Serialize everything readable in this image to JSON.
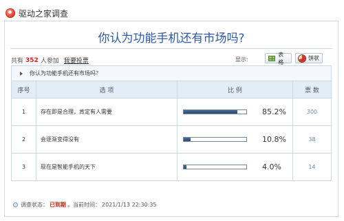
{
  "header": {
    "site_name": "驱动之家调查",
    "logo_icon": "globe-logo-icon"
  },
  "survey": {
    "title": "你认为功能手机还有市场吗?",
    "participants_prefix": "共有",
    "participants": "352",
    "participants_suffix": "人参加",
    "vote_link": "我要投票",
    "display_label": "显示:",
    "view_table": "表格",
    "view_pie": "饼状",
    "question_row": "你认为功能手机还有市场吗？"
  },
  "table": {
    "headers": {
      "no": "序号",
      "option": "选 项",
      "ratio": "比 例",
      "votes": "票 数"
    },
    "rows": [
      {
        "no": "1",
        "option": "存在即是合理，肯定有人需要",
        "percent_text": "85.2%",
        "fraction": 0.852,
        "votes": "300"
      },
      {
        "no": "2",
        "option": "会逐渐变得没有",
        "percent_text": "10.8%",
        "fraction": 0.108,
        "votes": "38"
      },
      {
        "no": "3",
        "option": "现在是智能手机的天下",
        "percent_text": "4.0%",
        "fraction": 0.04,
        "votes": "14"
      }
    ]
  },
  "status": {
    "label": "调查状态：",
    "state": "已到期",
    "time_label": "。当前时间：",
    "time": "2021/1/13 22:30:35"
  },
  "colors": {
    "title": "#2c5aa8",
    "accent_red": "#d0231a",
    "bar": "#2c4a72",
    "border": "#c9d7e6"
  }
}
